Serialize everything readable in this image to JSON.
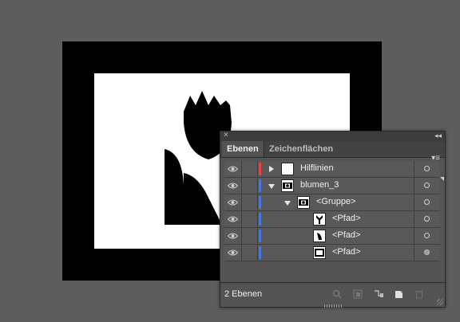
{
  "panel": {
    "close_glyph": "×",
    "collapse_glyph": "◂◂",
    "tabs": [
      {
        "label": "Ebenen",
        "active": true
      },
      {
        "label": "Zeichenflächen",
        "active": false
      }
    ],
    "menu_glyph": "▾≡",
    "layers": [
      {
        "label": "Hilflinien",
        "color": "#e04848",
        "expand": "right",
        "thumb": "blank",
        "target": "empty"
      },
      {
        "label": "blumen_3",
        "color": "#4a78d8",
        "expand": "down",
        "thumb": "group",
        "target": "empty"
      },
      {
        "label": "<Gruppe>",
        "color": "#4a78d8",
        "expand": "down",
        "thumb": "group",
        "target": "empty"
      },
      {
        "label": "<Pfad>",
        "color": "#4a78d8",
        "expand": "none",
        "thumb": "path-a",
        "target": "empty"
      },
      {
        "label": "<Pfad>",
        "color": "#4a78d8",
        "expand": "none",
        "thumb": "path-b",
        "target": "empty"
      },
      {
        "label": "<Pfad>",
        "color": "#4a78d8",
        "expand": "none",
        "thumb": "path-c",
        "target": "filled"
      }
    ],
    "footer": {
      "count": "2 Ebenen",
      "icons": [
        "locate-object-icon",
        "make-clipping-mask-icon",
        "new-sublayer-icon",
        "new-layer-icon",
        "delete-layer-icon"
      ]
    }
  }
}
